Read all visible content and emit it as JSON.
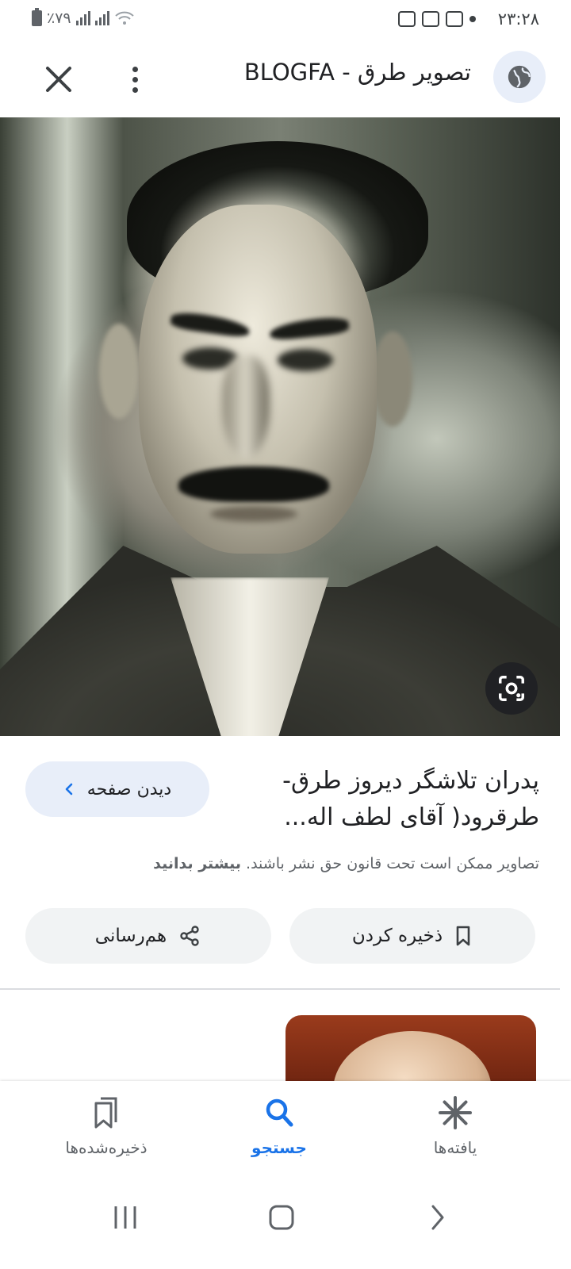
{
  "status_bar": {
    "time": "۲۳:۲۸",
    "battery": "٪۷۹"
  },
  "header": {
    "title": "تصویر طرق - BLOGFA"
  },
  "result": {
    "title": "پدران تلاشگر دیروز طرق- طرقرود( آقای لطف اله...",
    "view_page_label": "دیدن صفحه",
    "copyright_text": "تصاویر ممکن است تحت قانون حق نشر باشند.",
    "learn_more": "بیشتر بدانید",
    "save_label": "ذخیره کردن",
    "share_label": "هم‌رسانی"
  },
  "bottom_nav": {
    "items": [
      {
        "label": "ذخیره‌شده‌ها",
        "icon": "bookmarks-icon"
      },
      {
        "label": "جستجو",
        "icon": "search-icon"
      },
      {
        "label": "یافته‌ها",
        "icon": "asterisk-icon"
      }
    ],
    "active": "جستجو"
  },
  "colors": {
    "accent": "#1a73e8",
    "pill_bg": "#f1f3f4",
    "light_blue": "#e8eef9"
  }
}
